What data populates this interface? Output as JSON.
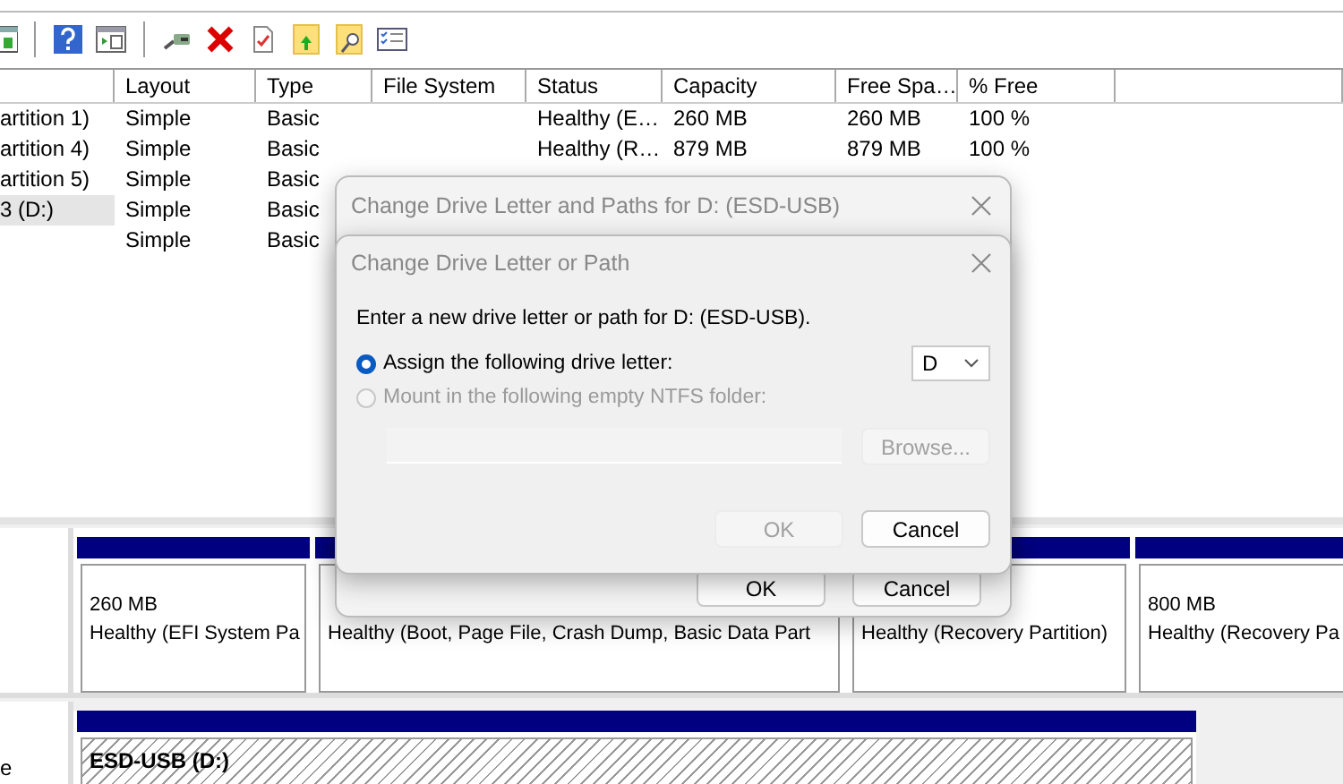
{
  "volume_list": {
    "columns": [
      "Layout",
      "Type",
      "File System",
      "Status",
      "Capacity",
      "Free Spa…",
      "% Free"
    ],
    "rows": [
      {
        "column_1": "artition 1)",
        "layout": "Simple",
        "type": "Basic",
        "status": "Healthy (E…",
        "capacity": "260 MB",
        "free_space": "260 MB",
        "percent_free": "100 %",
        "selected": false
      },
      {
        "column_1": "artition 4)",
        "layout": "Simple",
        "type": "Basic",
        "status": "Healthy (R…",
        "capacity": "879 MB",
        "free_space": "879 MB",
        "percent_free": "100 %",
        "selected": false
      },
      {
        "column_1": "artition 5)",
        "layout": "Simple",
        "type": "Basic",
        "selected": false
      },
      {
        "column_1": "3 (D:)",
        "layout": "Simple",
        "type": "Basic",
        "selected": true
      },
      {
        "layout": "Simple",
        "type": "Basic",
        "selected": false
      }
    ]
  },
  "disks": [
    {
      "partitions": [
        {
          "size": "260 MB",
          "status": "Healthy (EFI System Pa",
          "selected": false
        },
        {
          "status": "Healthy (Boot, Page File, Crash Dump, Basic Data Part",
          "selected": false
        },
        {
          "status": "Healthy (Recovery Partition)",
          "selected": false
        },
        {
          "size": "800 MB",
          "status": "Healthy (Recovery Pa",
          "selected": false
        }
      ]
    },
    {
      "label": "e",
      "partitions": [
        {
          "name": "ESD-USB  (D:)",
          "selected": true
        }
      ]
    }
  ],
  "paths_dialog": {
    "title": "Change Drive Letter and Paths for D: (ESD-USB)",
    "buttons": [
      {
        "label": "OK",
        "disabled": false
      },
      {
        "label": "Cancel",
        "disabled": false
      }
    ]
  },
  "letter_dialog": {
    "title": "Change Drive Letter or Path",
    "prompt": "Enter a new drive letter or path for D: (ESD-USB).",
    "options": [
      {
        "label": "Assign the following drive letter:",
        "selected": true,
        "disabled": false
      },
      {
        "label": "Mount in the following empty NTFS folder:",
        "selected": false,
        "disabled": true
      }
    ],
    "drive_letter": {
      "value": "D"
    },
    "folder_field": {
      "disabled": true
    },
    "browse_button": {
      "label": "Browse...",
      "disabled": true
    },
    "buttons": [
      {
        "label": "OK",
        "disabled": true
      },
      {
        "label": "Cancel",
        "disabled": false
      }
    ]
  }
}
